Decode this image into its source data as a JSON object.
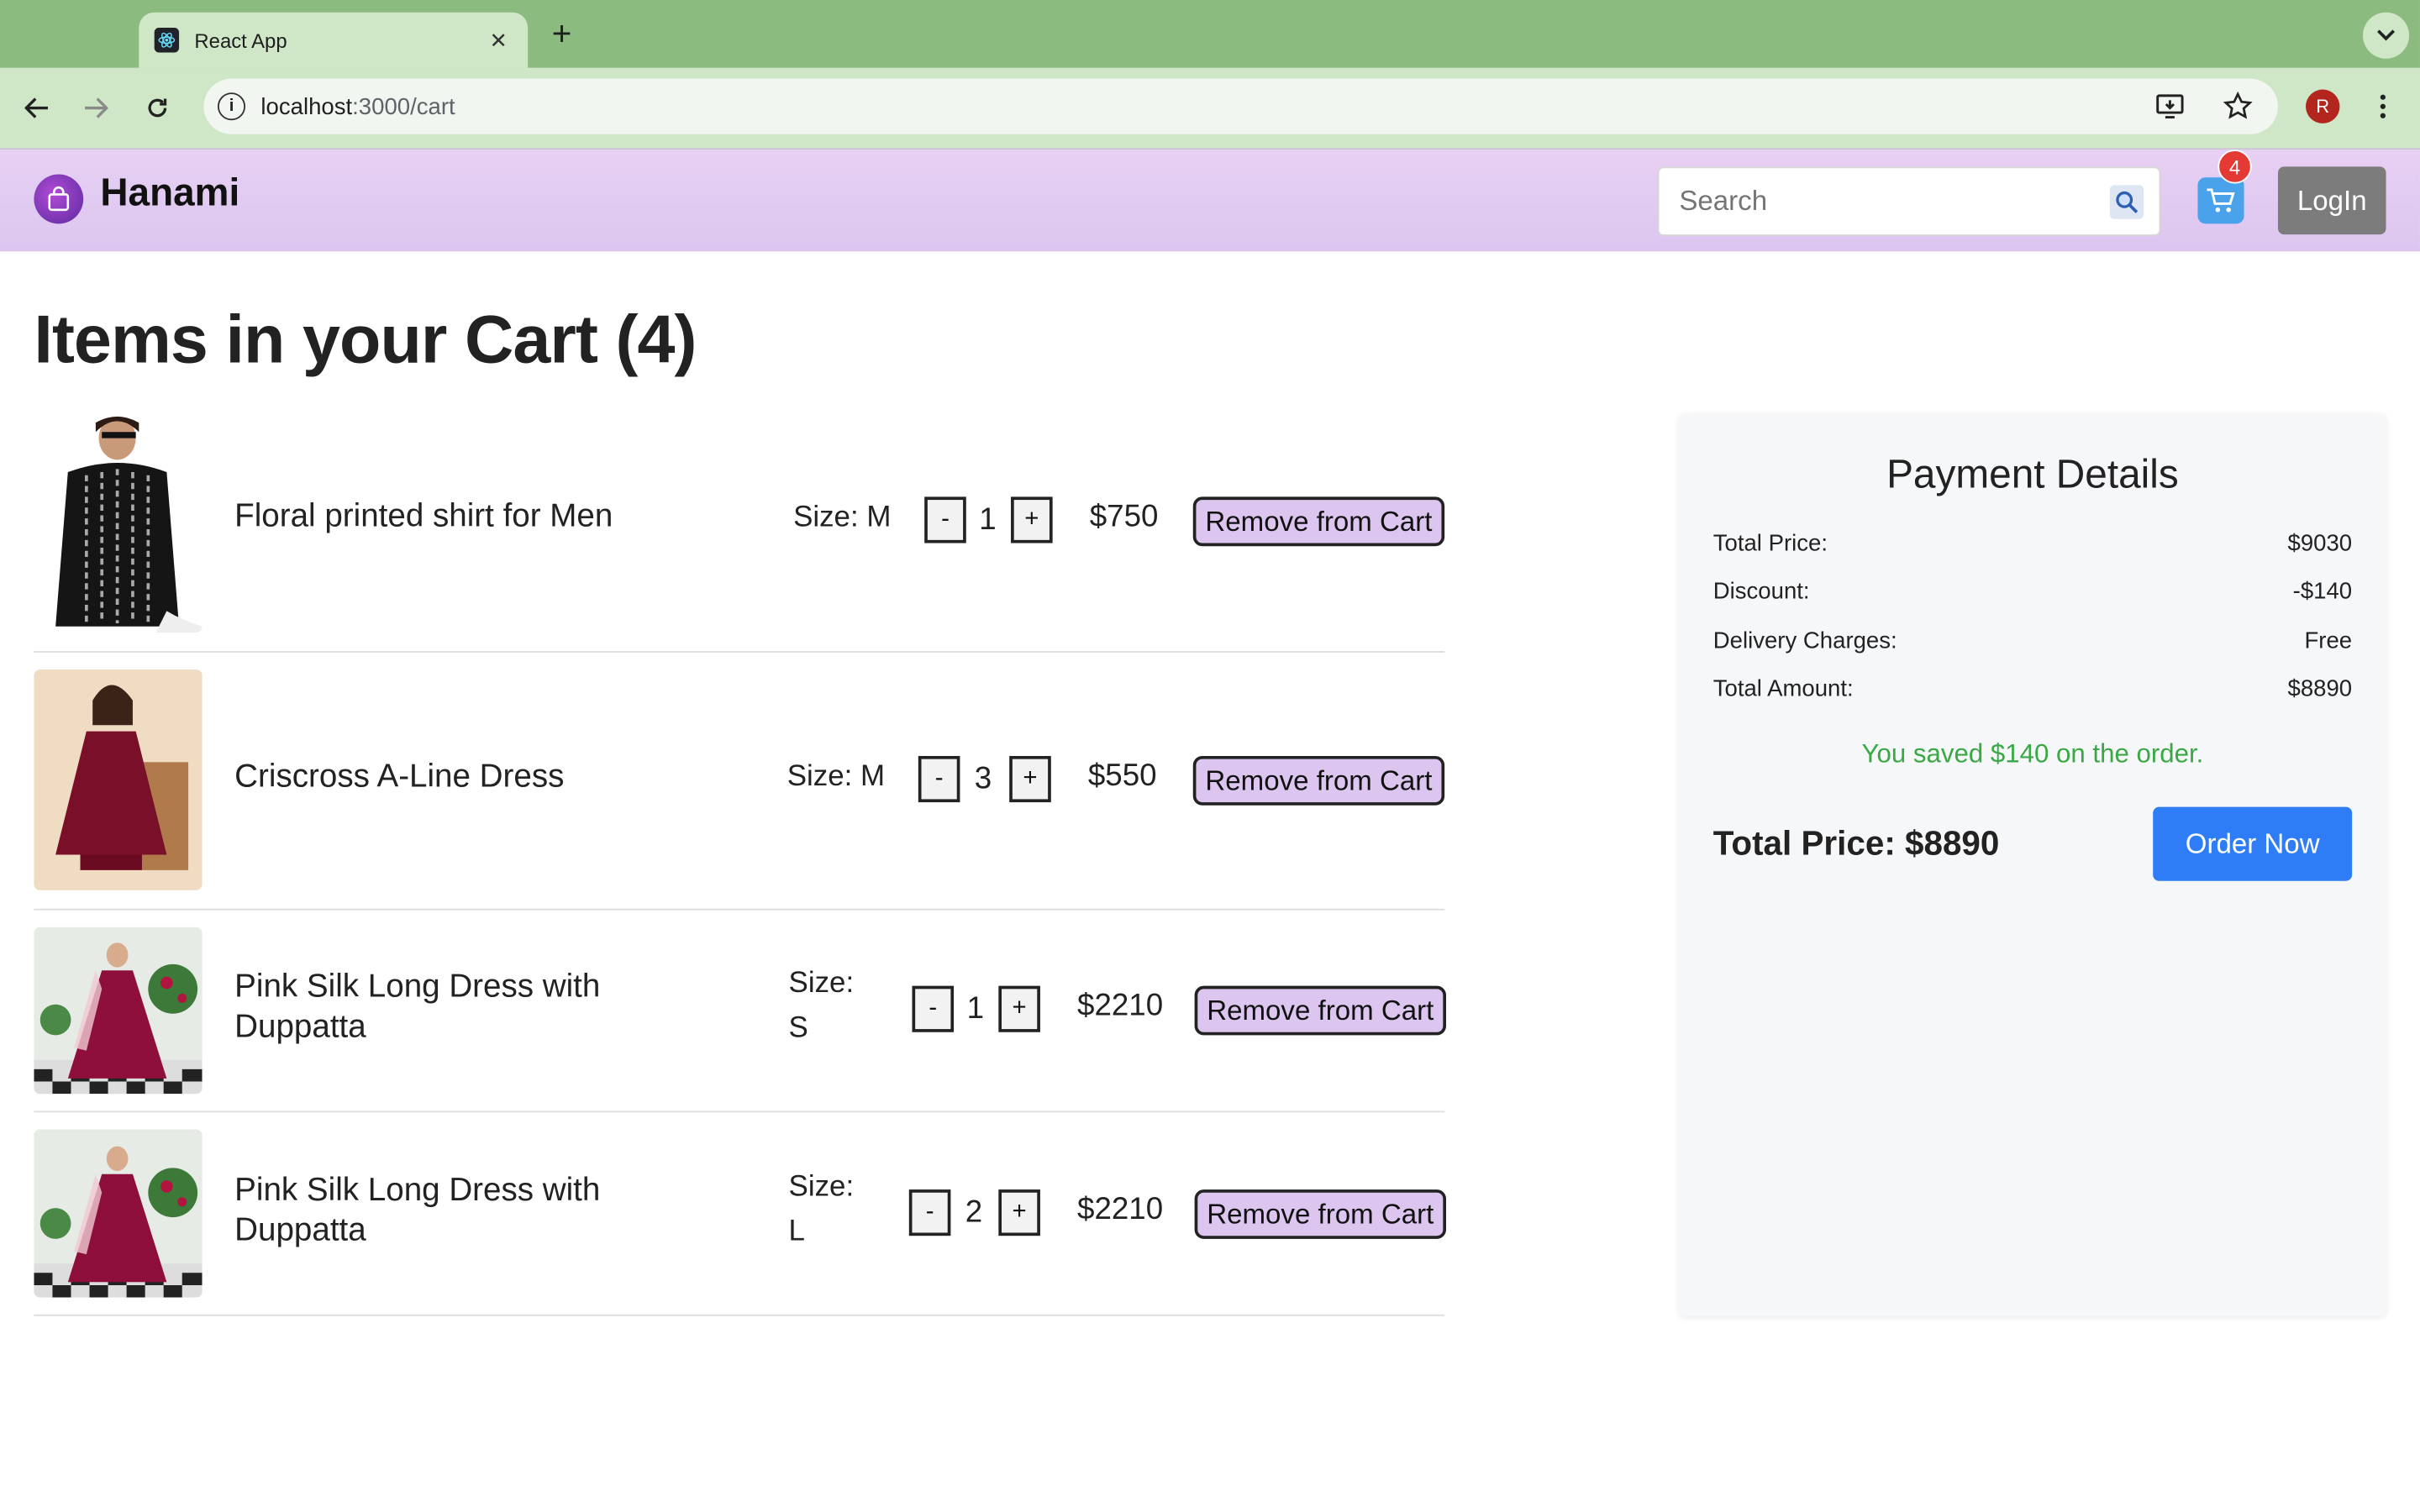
{
  "browser": {
    "tab_title": "React App",
    "url_host": "localhost",
    "url_path": ":3000/cart",
    "profile_initial": "R"
  },
  "header": {
    "brand": "Hanami",
    "search_placeholder": "Search",
    "cart_count": "4",
    "login_label": "LogIn"
  },
  "cart": {
    "heading": "Items in your Cart (4)",
    "size_prefix": "Size:",
    "minus": "-",
    "plus": "+",
    "remove_label": "Remove from Cart",
    "items": [
      {
        "name": "Floral printed shirt for Men",
        "size": "Size: M",
        "qty": "1",
        "price": "$750"
      },
      {
        "name": "Criscross A-Line Dress",
        "size": "Size: M",
        "qty": "3",
        "price": "$550"
      },
      {
        "name": "Pink Silk Long Dress with Duppatta",
        "size_label": "Size:",
        "size_value": "S",
        "qty": "1",
        "price": "$2210"
      },
      {
        "name": "Pink Silk Long Dress with Duppatta",
        "size_label": "Size:",
        "size_value": "L",
        "qty": "2",
        "price": "$2210"
      }
    ]
  },
  "payment": {
    "title": "Payment Details",
    "rows": [
      {
        "label": "Total Price:",
        "value": "$9030"
      },
      {
        "label": "Discount:",
        "value": "-$140"
      },
      {
        "label": "Delivery Charges:",
        "value": "Free"
      },
      {
        "label": "Total Amount:",
        "value": "$8890"
      }
    ],
    "saved_message": "You saved $140 on the order.",
    "total_label": "Total Price: $8890",
    "order_button": "Order Now",
    "saved_color": "#3aa845",
    "order_color": "#2f7df6"
  }
}
